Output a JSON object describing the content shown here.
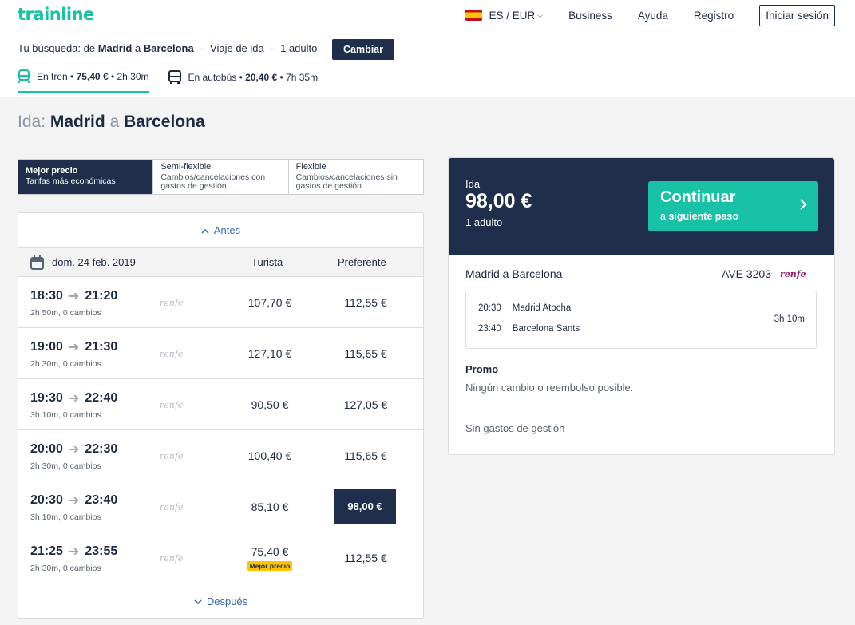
{
  "header": {
    "logo": "trainline",
    "lang": "ES / EUR",
    "nav": [
      "Business",
      "Ayuda",
      "Registro"
    ],
    "signin": "Iniciar sesión"
  },
  "search": {
    "prefix": "Tu búsqueda: de",
    "from": "Madrid",
    "a": "a",
    "to": "Barcelona",
    "trip": "Viaje de ida",
    "passengers": "1 adulto",
    "change_button": "Cambiar"
  },
  "modes": [
    {
      "label": "En tren",
      "price": "75,40 €",
      "duration": "2h 30m",
      "icon": "train-icon"
    },
    {
      "label": "En autobús",
      "price": "20,40 €",
      "duration": "7h 35m",
      "icon": "bus-icon"
    }
  ],
  "heading": {
    "prefix": "Ida:",
    "from": "Madrid",
    "a": "a",
    "to": "Barcelona"
  },
  "fare_tabs": [
    {
      "title": "Mejor precio",
      "desc": "Tarifas más económicas"
    },
    {
      "title": "Semi-flexible",
      "desc": "Cambios/cancelaciones con gastos de gestión"
    },
    {
      "title": "Flexible",
      "desc": "Cambios/cancelaciones sin gastos de gestión"
    }
  ],
  "list": {
    "before": "Antes",
    "after": "Después",
    "date": "dom. 24 feb. 2019",
    "col1": "Turista",
    "col2": "Preferente",
    "best_badge": "Mejor precio",
    "operator": "renfe",
    "rows": [
      {
        "dep": "18:30",
        "arr": "21:20",
        "info": "2h 50m, 0 cambios",
        "p1": "107,70 €",
        "p2": "112,55 €"
      },
      {
        "dep": "19:00",
        "arr": "21:30",
        "info": "2h 30m, 0 cambios",
        "p1": "127,10 €",
        "p2": "115,65 €"
      },
      {
        "dep": "19:30",
        "arr": "22:40",
        "info": "3h 10m, 0 cambios",
        "p1": "90,50 €",
        "p2": "127,05 €"
      },
      {
        "dep": "20:00",
        "arr": "22:30",
        "info": "2h 30m, 0 cambios",
        "p1": "100,40 €",
        "p2": "115,65 €"
      },
      {
        "dep": "20:30",
        "arr": "23:40",
        "info": "3h 10m, 0 cambios",
        "p1": "85,10 €",
        "p2": "98,00 €"
      },
      {
        "dep": "21:25",
        "arr": "23:55",
        "info": "2h 30m, 0 cambios",
        "p1": "75,40 €",
        "p2": "112,55 €"
      }
    ]
  },
  "summary": {
    "ida": "Ida",
    "price": "98,00 €",
    "adult": "1 adulto",
    "continue": "Continuar",
    "continue_sub_a": "a",
    "continue_sub_b": "siguiente paso",
    "route": "Madrid a Barcelona",
    "train": "AVE 3203",
    "operator": "renfe",
    "dep_time": "20:30",
    "dep_station": "Madrid Atocha",
    "arr_time": "23:40",
    "arr_station": "Barcelona Sants",
    "duration": "3h 10m",
    "promo": "Promo",
    "promo_desc": "Ningún cambio o reembolso posible.",
    "fees": "Sin gastos de gestión"
  }
}
